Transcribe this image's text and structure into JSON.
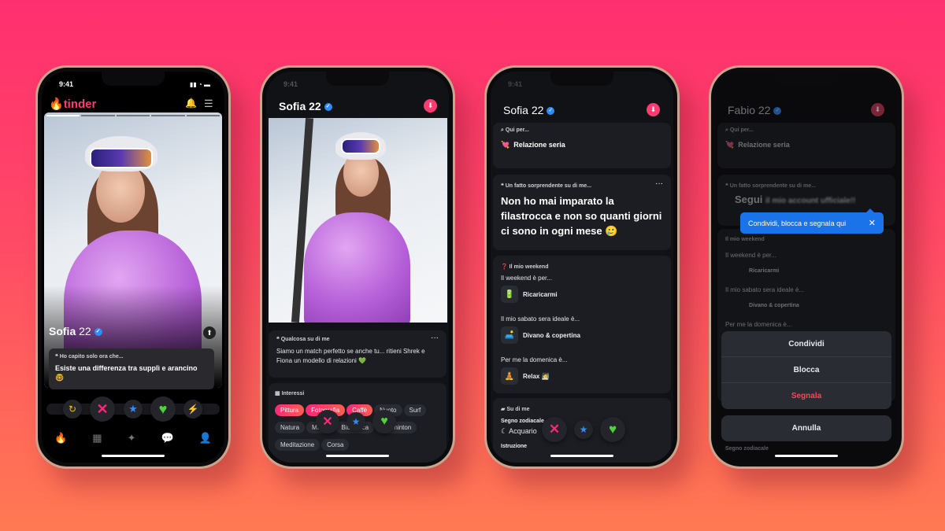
{
  "colors": {
    "brand": "#fe3c72",
    "super_like": "#2f8cff",
    "like": "#4fd13a",
    "nope": "#fd267a",
    "tooltip": "#1a73e8",
    "danger": "#ff4458"
  },
  "phone1": {
    "status_time": "9:41",
    "logo": "tinder",
    "header_icons": [
      "bell-icon",
      "sliders-icon"
    ],
    "profile_name": "Sofia",
    "profile_age": "22",
    "prompt_label": "Ho capito solo ora che...",
    "prompt_answer": "Esiste una differenza tra supplì e arancino 🤓",
    "actions": [
      "rewind-icon",
      "nope-icon",
      "super-like-icon",
      "like-icon",
      "boost-icon"
    ],
    "tabs": [
      "flame-icon",
      "explore-icon",
      "sparkle-icon",
      "chat-icon",
      "profile-icon"
    ]
  },
  "phone2": {
    "status_time": "9:41",
    "profile_name": "Sofia",
    "profile_age": "22",
    "about_label": "Qualcosa su di me",
    "about_text": "Siamo un match perfetto se anche tu... ritieni Shrek e Fiona un modello di relazioni 💚",
    "more": "···",
    "interests_label": "Interessi",
    "interests": [
      {
        "label": "Pittura",
        "selected": true
      },
      {
        "label": "Fotografia",
        "selected": true
      },
      {
        "label": "Caffè",
        "selected": true
      },
      {
        "label": "Nuoto",
        "selected": false
      },
      {
        "label": "Surf",
        "selected": false
      },
      {
        "label": "Natura",
        "selected": false
      },
      {
        "label": "Musei",
        "selected": false
      },
      {
        "label": "Biblioteca",
        "selected": false
      },
      {
        "label": "Badminton",
        "selected": false
      },
      {
        "label": "Meditazione",
        "selected": false
      },
      {
        "label": "Corsa",
        "selected": false
      }
    ]
  },
  "phone3": {
    "status_time": "9:41",
    "profile_name": "Sofia",
    "profile_age": "22",
    "looking_label": "Qui per...",
    "looking_value": "Relazione seria",
    "looking_emoji": "💘",
    "fact_label": "Un fatto sorprendente su di me...",
    "fact_text": "Non ho mai imparato la filastrocca e non so quanti giorni ci sono in ogni mese 🥲",
    "more": "···",
    "weekend_label": "Il mio weekend",
    "weekend": [
      {
        "q": "Il weekend è per...",
        "a": "Ricaricarmi",
        "emoji": "🔋"
      },
      {
        "q": "Il mio sabato sera ideale è...",
        "a": "Divano & copertina",
        "emoji": "🛋️"
      },
      {
        "q": "Per me la domenica è...",
        "a": "Relax 🧖",
        "emoji": "🧘"
      }
    ],
    "about_label": "Su di me",
    "zodiac_label": "Segno zodiacale",
    "zodiac_value": "Acquario",
    "education_label": "Istruzione"
  },
  "phone4": {
    "profile_name": "Fabio",
    "profile_age": "22",
    "looking_label": "Qui per...",
    "looking_value": "Relazione seria",
    "fact_label": "Un fatto sorprendente su di me...",
    "fact_text": "Segui",
    "fact_blurred": "il mio account ufficiale!!",
    "tooltip": "Condividi, blocca e segnala qui",
    "weekend_label": "Il mio weekend",
    "weekend_q1": "Il weekend è per...",
    "weekend_a1": "Ricaricarmi",
    "weekend_q2": "Il mio sabato sera ideale è...",
    "weekend_a2": "Divano & copertina",
    "weekend_q3": "Per me la domenica è...",
    "zodiac_label": "Segno zodiacale",
    "sheet": {
      "share": "Condividi",
      "block": "Blocca",
      "report": "Segnala",
      "cancel": "Annulla"
    }
  }
}
